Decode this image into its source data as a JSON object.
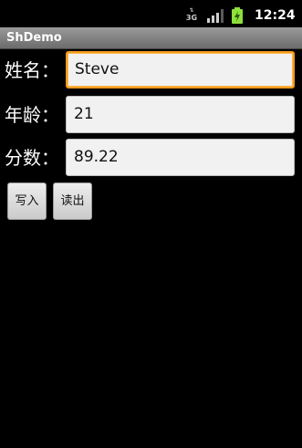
{
  "status_bar": {
    "network_icon": "3g-data-icon",
    "network_label": "3G",
    "signal_icon": "signal-strength-icon",
    "battery_icon": "battery-charging-icon",
    "time": "12:24"
  },
  "app": {
    "title": "ShDemo"
  },
  "form": {
    "name_label": "姓名：",
    "name_value": "Steve",
    "age_label": "年龄：",
    "age_value": "21",
    "score_label": "分数：",
    "score_value": "89.22"
  },
  "actions": {
    "write_label": "写入",
    "read_label": "读出"
  },
  "colors": {
    "background": "#000000",
    "focus_accent": "#f39a1e",
    "battery": "#8ee03a"
  }
}
